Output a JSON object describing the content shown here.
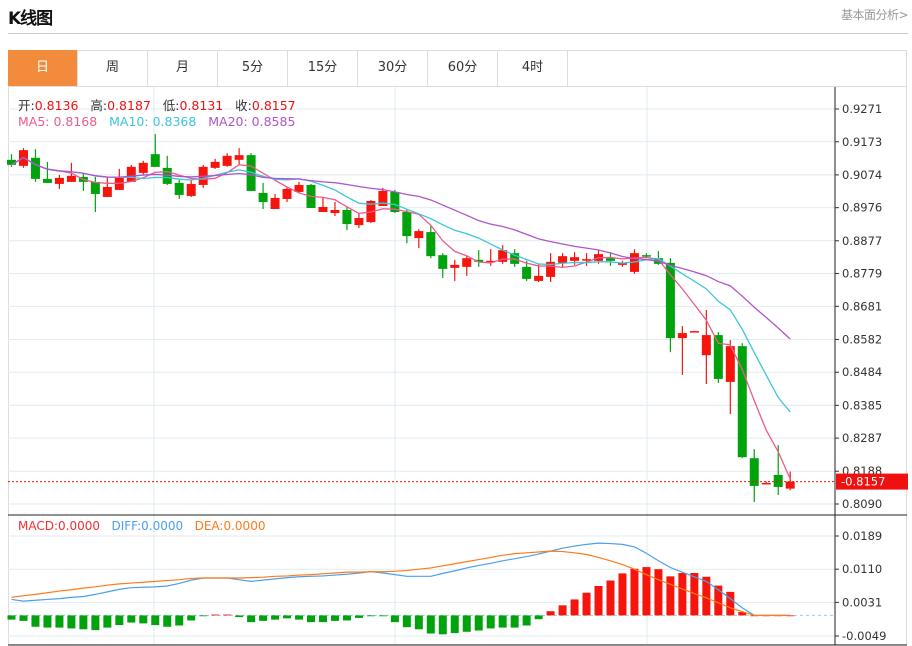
{
  "header": {
    "title": "K线图",
    "link": "基本面分析>"
  },
  "tabs": [
    {
      "label": "日",
      "active": true
    },
    {
      "label": "周"
    },
    {
      "label": "月"
    },
    {
      "label": "5分"
    },
    {
      "label": "15分"
    },
    {
      "label": "30分"
    },
    {
      "label": "60分"
    },
    {
      "label": "4时"
    }
  ],
  "ohlc_info": {
    "open_label": "开:",
    "open": "0.8136",
    "high_label": "高:",
    "high": "0.8187",
    "low_label": "低:",
    "low": "0.8131",
    "close_label": "收:",
    "close": "0.8157"
  },
  "ma_info": {
    "ma5": "MA5: 0.8168",
    "ma10": "MA10: 0.8368",
    "ma20": "MA20: 0.8585"
  },
  "macd_info": {
    "macd": "MACD:0.0000",
    "diff": "DIFF:0.0000",
    "dea": "DEA:0.0000"
  },
  "colors": {
    "accent": "#F28C3C",
    "up": "#F5150D",
    "down": "#00A30C",
    "ma5": "#EE5A8C",
    "ma10": "#3CC6DA",
    "ma20": "#B055C8",
    "diff": "#4AA0EE",
    "dea": "#FF7A1A"
  },
  "chart_data": [
    {
      "type": "candlestick",
      "ylim": [
        0.809,
        0.9271
      ],
      "y_ticks": [
        "0.9271",
        "0.9173",
        "0.9074",
        "0.8976",
        "0.8877",
        "0.8779",
        "0.8681",
        "0.8582",
        "0.8484",
        "0.8385",
        "0.8287",
        "0.8188",
        "0.8090"
      ],
      "current_price": "0.8157",
      "ma_periods": [
        5,
        10,
        20
      ],
      "ohlc": [
        [
          0.9119,
          0.9136,
          0.9098,
          0.9104
        ],
        [
          0.9101,
          0.9154,
          0.9095,
          0.9148
        ],
        [
          0.9125,
          0.9151,
          0.9053,
          0.9062
        ],
        [
          0.9062,
          0.9113,
          0.905,
          0.905
        ],
        [
          0.9047,
          0.9074,
          0.9032,
          0.9065
        ],
        [
          0.9053,
          0.911,
          0.9053,
          0.9071
        ],
        [
          0.9068,
          0.9077,
          0.9026,
          0.9053
        ],
        [
          0.9053,
          0.9068,
          0.8963,
          0.9017
        ],
        [
          0.9008,
          0.9068,
          0.9008,
          0.9038
        ],
        [
          0.9029,
          0.9092,
          0.9029,
          0.9065
        ],
        [
          0.9053,
          0.9104,
          0.9053,
          0.9098
        ],
        [
          0.908,
          0.9116,
          0.9074,
          0.911
        ],
        [
          0.9136,
          0.9196,
          0.9098,
          0.9098
        ],
        [
          0.9095,
          0.9131,
          0.9044,
          0.9047
        ],
        [
          0.905,
          0.9059,
          0.9002,
          0.9014
        ],
        [
          0.9011,
          0.9059,
          0.9008,
          0.9047
        ],
        [
          0.9044,
          0.9104,
          0.9035,
          0.9098
        ],
        [
          0.9095,
          0.9122,
          0.9092,
          0.9113
        ],
        [
          0.9101,
          0.9139,
          0.9098,
          0.9131
        ],
        [
          0.9119,
          0.9154,
          0.9104,
          0.9133
        ],
        [
          0.9133,
          0.9139,
          0.9026,
          0.9026
        ],
        [
          0.902,
          0.905,
          0.8972,
          0.8993
        ],
        [
          0.8972,
          0.9017,
          0.8972,
          0.9005
        ],
        [
          0.9002,
          0.9038,
          0.8993,
          0.9032
        ],
        [
          0.9023,
          0.9053,
          0.902,
          0.9044
        ],
        [
          0.9044,
          0.9047,
          0.8975,
          0.8975
        ],
        [
          0.8963,
          0.9005,
          0.8963,
          0.8978
        ],
        [
          0.896,
          0.8993,
          0.8951,
          0.8969
        ],
        [
          0.8969,
          0.8978,
          0.8909,
          0.8927
        ],
        [
          0.8924,
          0.896,
          0.8915,
          0.8945
        ],
        [
          0.8933,
          0.8999,
          0.893,
          0.8996
        ],
        [
          0.8981,
          0.9035,
          0.8981,
          0.9026
        ],
        [
          0.9023,
          0.9029,
          0.896,
          0.8963
        ],
        [
          0.8963,
          0.8972,
          0.887,
          0.8891
        ],
        [
          0.8885,
          0.8912,
          0.8855,
          0.8906
        ],
        [
          0.8903,
          0.8921,
          0.8825,
          0.8831
        ],
        [
          0.8834,
          0.884,
          0.8766,
          0.8793
        ],
        [
          0.8796,
          0.882,
          0.8757,
          0.8805
        ],
        [
          0.8799,
          0.8831,
          0.8772,
          0.8825
        ],
        [
          0.882,
          0.8849,
          0.8799,
          0.8814
        ],
        [
          0.8814,
          0.8852,
          0.8802,
          0.8817
        ],
        [
          0.8814,
          0.8864,
          0.8808,
          0.8849
        ],
        [
          0.884,
          0.8852,
          0.8799,
          0.8808
        ],
        [
          0.8799,
          0.8817,
          0.8757,
          0.8763
        ],
        [
          0.8757,
          0.8808,
          0.8754,
          0.8772
        ],
        [
          0.8769,
          0.884,
          0.8754,
          0.8814
        ],
        [
          0.8811,
          0.884,
          0.8799,
          0.8831
        ],
        [
          0.8817,
          0.8843,
          0.8805,
          0.8828
        ],
        [
          0.882,
          0.884,
          0.8802,
          0.8822
        ],
        [
          0.8817,
          0.8849,
          0.8808,
          0.8837
        ],
        [
          0.8825,
          0.8843,
          0.8802,
          0.8817
        ],
        [
          0.8805,
          0.8817,
          0.8799,
          0.8811
        ],
        [
          0.8784,
          0.8852,
          0.8778,
          0.884
        ],
        [
          0.8834,
          0.884,
          0.8825,
          0.8831
        ],
        [
          0.8825,
          0.8846,
          0.8805,
          0.8808
        ],
        [
          0.8811,
          0.8825,
          0.8544,
          0.8586
        ],
        [
          0.8586,
          0.8622,
          0.8476,
          0.8601
        ],
        [
          0.8604,
          0.8607,
          0.8604,
          0.8607
        ],
        [
          0.8535,
          0.867,
          0.8449,
          0.8595
        ],
        [
          0.8595,
          0.8604,
          0.8452,
          0.8464
        ],
        [
          0.8455,
          0.858,
          0.8359,
          0.8562
        ],
        [
          0.8562,
          0.8571,
          0.8227,
          0.823
        ],
        [
          0.8227,
          0.8254,
          0.8096,
          0.8144
        ],
        [
          0.815,
          0.8157,
          0.815,
          0.8153
        ],
        [
          0.8177,
          0.8266,
          0.8117,
          0.8141
        ],
        [
          0.8136,
          0.8187,
          0.8131,
          0.8157
        ]
      ]
    },
    {
      "type": "bar+line",
      "ylim": [
        -0.0049,
        0.0189
      ],
      "y_ticks": [
        "0.0189",
        "0.0110",
        "0.0031",
        "-0.0049"
      ],
      "macd_hist": [
        -0.001,
        -0.0013,
        -0.0027,
        -0.0029,
        -0.0029,
        -0.0031,
        -0.0033,
        -0.0035,
        -0.0029,
        -0.0023,
        -0.0017,
        -0.0019,
        -0.0023,
        -0.0027,
        -0.0024,
        -0.0012,
        -0.0002,
        0.0002,
        0.0002,
        -0.0004,
        -0.0016,
        -0.0013,
        -0.001,
        -0.0007,
        -0.001,
        -0.0016,
        -0.0016,
        -0.0013,
        -0.0012,
        -0.0006,
        -0.0002,
        -0.0002,
        -0.0016,
        -0.0028,
        -0.0033,
        -0.0043,
        -0.0045,
        -0.0042,
        -0.0039,
        -0.0036,
        -0.0031,
        -0.0029,
        -0.0029,
        -0.0024,
        -0.0009,
        0.001,
        0.0024,
        0.0038,
        0.0054,
        0.007,
        0.0083,
        0.01,
        0.0111,
        0.0115,
        0.011,
        0.0093,
        0.0101,
        0.0101,
        0.0092,
        0.0071,
        0.0056,
        0.0008,
        0,
        0,
        0,
        0
      ],
      "diff": [
        0.0038,
        0.0034,
        0.0036,
        0.0038,
        0.004,
        0.0043,
        0.0045,
        0.005,
        0.0056,
        0.0062,
        0.0066,
        0.0067,
        0.0068,
        0.007,
        0.0076,
        0.0084,
        0.0089,
        0.0089,
        0.0089,
        0.0085,
        0.0081,
        0.0084,
        0.0087,
        0.009,
        0.0092,
        0.0093,
        0.0094,
        0.0096,
        0.0098,
        0.0101,
        0.0104,
        0.0101,
        0.0097,
        0.0093,
        0.0093,
        0.0093,
        0.01,
        0.0106,
        0.0113,
        0.0119,
        0.0124,
        0.013,
        0.0135,
        0.014,
        0.0146,
        0.0153,
        0.016,
        0.0165,
        0.0169,
        0.0172,
        0.0171,
        0.0169,
        0.0163,
        0.0148,
        0.013,
        0.0114,
        0.0103,
        0.0092,
        0.0081,
        0.0061,
        0.004,
        0.0018,
        0,
        0,
        0,
        0
      ],
      "dea": [
        0.0043,
        0.0047,
        0.005,
        0.0054,
        0.0058,
        0.0061,
        0.0065,
        0.0068,
        0.0072,
        0.0075,
        0.0077,
        0.0079,
        0.0081,
        0.0083,
        0.0085,
        0.0088,
        0.0089,
        0.0089,
        0.0089,
        0.0089,
        0.009,
        0.0091,
        0.0093,
        0.0094,
        0.0096,
        0.0097,
        0.0099,
        0.0101,
        0.0103,
        0.0103,
        0.0104,
        0.0104,
        0.0105,
        0.0107,
        0.011,
        0.0113,
        0.0118,
        0.0123,
        0.0128,
        0.0133,
        0.0138,
        0.0143,
        0.0147,
        0.0149,
        0.0151,
        0.0153,
        0.0152,
        0.0149,
        0.0145,
        0.0138,
        0.013,
        0.0121,
        0.011,
        0.0097,
        0.0085,
        0.0074,
        0.0063,
        0.0052,
        0.0042,
        0.003,
        0.0018,
        0.0009,
        0,
        0,
        0,
        0
      ]
    }
  ]
}
